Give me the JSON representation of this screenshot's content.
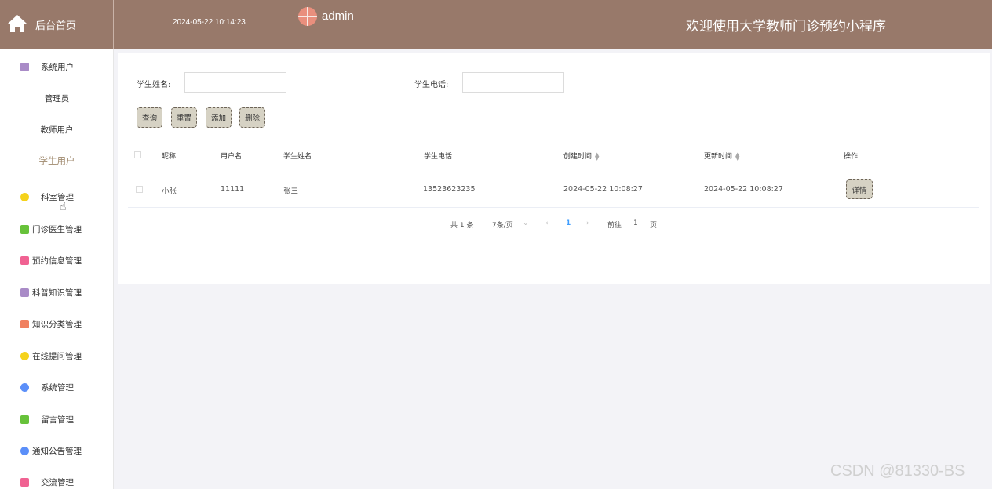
{
  "header": {
    "brand_label": "后台首页",
    "datetime": "2024-05-22 10:14:23",
    "user_name": "admin",
    "welcome": "欢迎使用大学教师门诊预约小程序",
    "bg_color": "#98796a"
  },
  "sidebar": {
    "items": [
      {
        "label": "系统用户",
        "icon": "archive-icon",
        "color": "#a98bc7"
      },
      {
        "label": "管理员"
      },
      {
        "label": "教师用户"
      },
      {
        "label": "学生用户"
      },
      {
        "label": "科室管理",
        "icon": "cube-icon",
        "color": "#f5d21b"
      },
      {
        "label": "门诊医生管理",
        "icon": "message-icon",
        "color": "#67c23a"
      },
      {
        "label": "预约信息管理",
        "icon": "calendar-icon",
        "color": "#f06292"
      },
      {
        "label": "科普知识管理",
        "icon": "archive-icon",
        "color": "#a98bc7"
      },
      {
        "label": "知识分类管理",
        "icon": "grid-icon",
        "color": "#f08060"
      },
      {
        "label": "在线提问管理",
        "icon": "cube-icon",
        "color": "#f5d21b"
      },
      {
        "label": "系统管理",
        "icon": "star-icon",
        "color": "#5b8ff9"
      },
      {
        "label": "留言管理",
        "icon": "message-icon",
        "color": "#67c23a"
      },
      {
        "label": "通知公告管理",
        "icon": "star-icon",
        "color": "#5b8ff9"
      },
      {
        "label": "交流管理",
        "icon": "calendar-icon",
        "color": "#f06292"
      }
    ]
  },
  "search": {
    "name_label": "学生姓名:",
    "name_value": "",
    "phone_label": "学生电话:",
    "phone_value": ""
  },
  "toolbar": {
    "query": "查询",
    "reset": "重置",
    "add": "添加",
    "delete": "删除"
  },
  "table": {
    "headers": {
      "nickname": "昵称",
      "username": "用户名",
      "student_name": "学生姓名",
      "student_phone": "学生电话",
      "created": "创建时间",
      "updated": "更新时间",
      "actions": "操作"
    },
    "rows": [
      {
        "nickname": "小张",
        "username": "11111",
        "student_name": "张三",
        "student_phone": "13523623235",
        "created": "2024-05-22 10:08:27",
        "updated": "2024-05-22 10:08:27",
        "action": "详情"
      }
    ]
  },
  "pagination": {
    "total": "共 1 条",
    "page_size": "7条/页",
    "current": "1",
    "goto_label": "前往",
    "goto_value": "1",
    "page_suffix": "页"
  },
  "watermark": "CSDN @81330-BS"
}
